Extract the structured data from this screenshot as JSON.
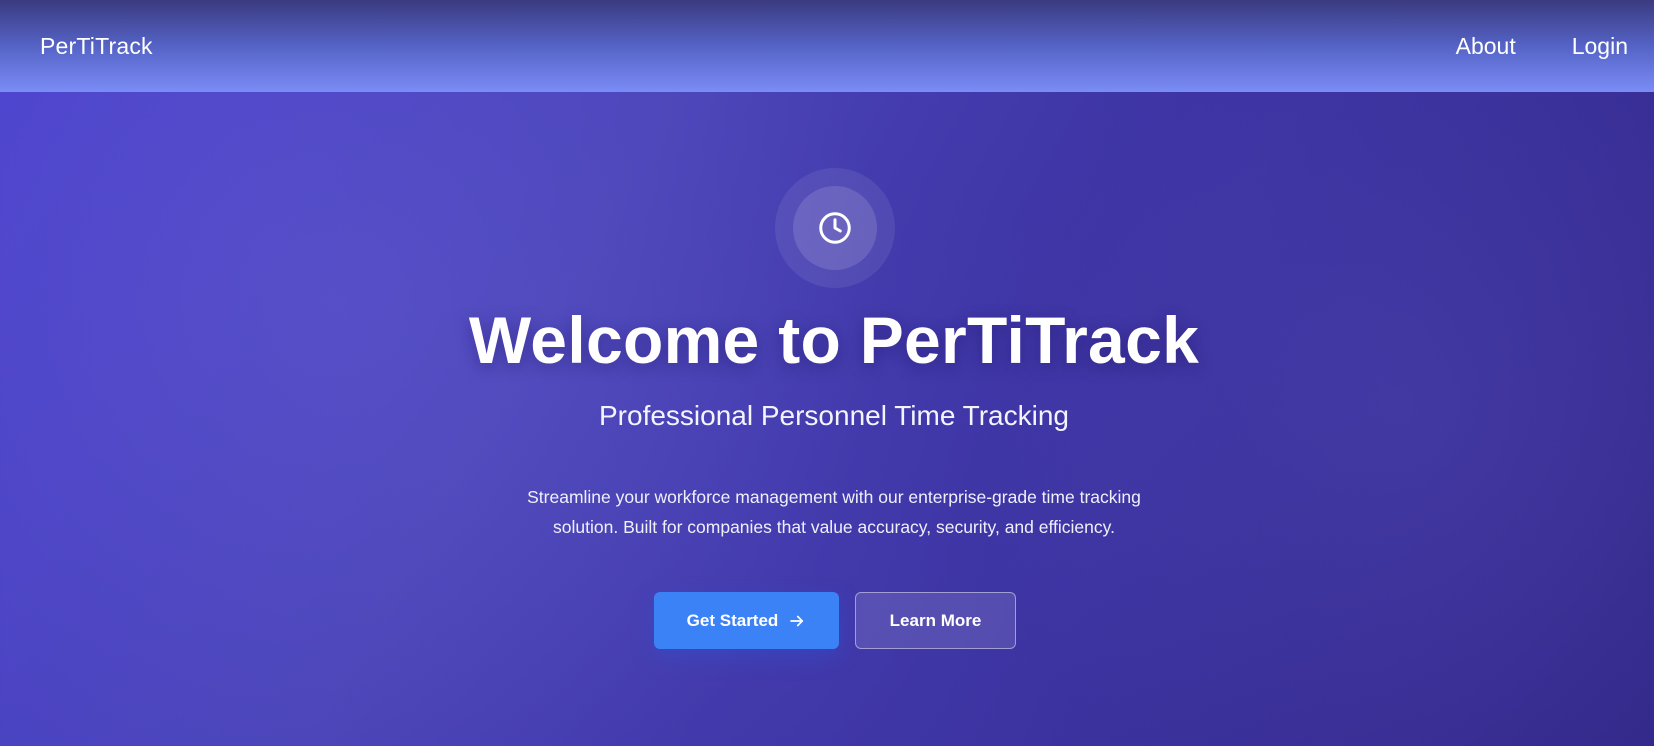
{
  "header": {
    "brand": "PerTiTrack",
    "nav": [
      {
        "label": "About"
      },
      {
        "label": "Login"
      }
    ]
  },
  "hero": {
    "icon": "clock-icon",
    "title": "Welcome to PerTiTrack",
    "subtitle": "Professional Personnel Time Tracking",
    "description": "Streamline your workforce management with our enterprise-grade time tracking solution. Built for companies that value accuracy, security, and efficiency.",
    "primary_button": {
      "label": "Get Started",
      "icon": "arrow-right-icon"
    },
    "secondary_button": {
      "label": "Learn More"
    }
  },
  "colors": {
    "header_top": "#3a3a80",
    "header_bottom": "#7a8cf6",
    "background_start": "#4b42cf",
    "background_end": "#33298a",
    "primary_button": "#3b82f6",
    "text": "#ffffff"
  }
}
